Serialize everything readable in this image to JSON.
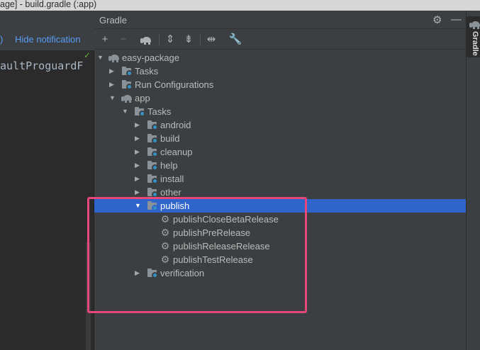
{
  "window": {
    "title": "age] - build.gradle (:app)"
  },
  "editor": {
    "notification_edge": ")",
    "hide_notification_label": "Hide notification",
    "code_fragment": "aultProguardF",
    "check_symbol": "✓"
  },
  "panel": {
    "title": "Gradle",
    "settings_icon": "⚙",
    "minimize_icon": "—",
    "toolbar": {
      "add": "+",
      "remove": "−",
      "collapse_all": "⇕",
      "expand_all": "⇟",
      "toggle_offline": "⇹",
      "settings": "🔧"
    }
  },
  "tree": {
    "root": "easy-package",
    "root_children": [
      "Tasks",
      "Run Configurations"
    ],
    "app": "app",
    "app_tasks": "Tasks",
    "task_groups_before": [
      "android",
      "build",
      "cleanup",
      "help",
      "install",
      "other"
    ],
    "selected_group": "publish",
    "publish_tasks": [
      "publishCloseBetaRelease",
      "publishPreRelease",
      "publishReleaseRelease",
      "publishTestRelease"
    ],
    "task_groups_after": [
      "verification"
    ]
  },
  "right_strip": {
    "label": "Gradle"
  },
  "colors": {
    "selection": "#2f65ca",
    "highlight": "#e8477a",
    "link": "#589df6"
  }
}
